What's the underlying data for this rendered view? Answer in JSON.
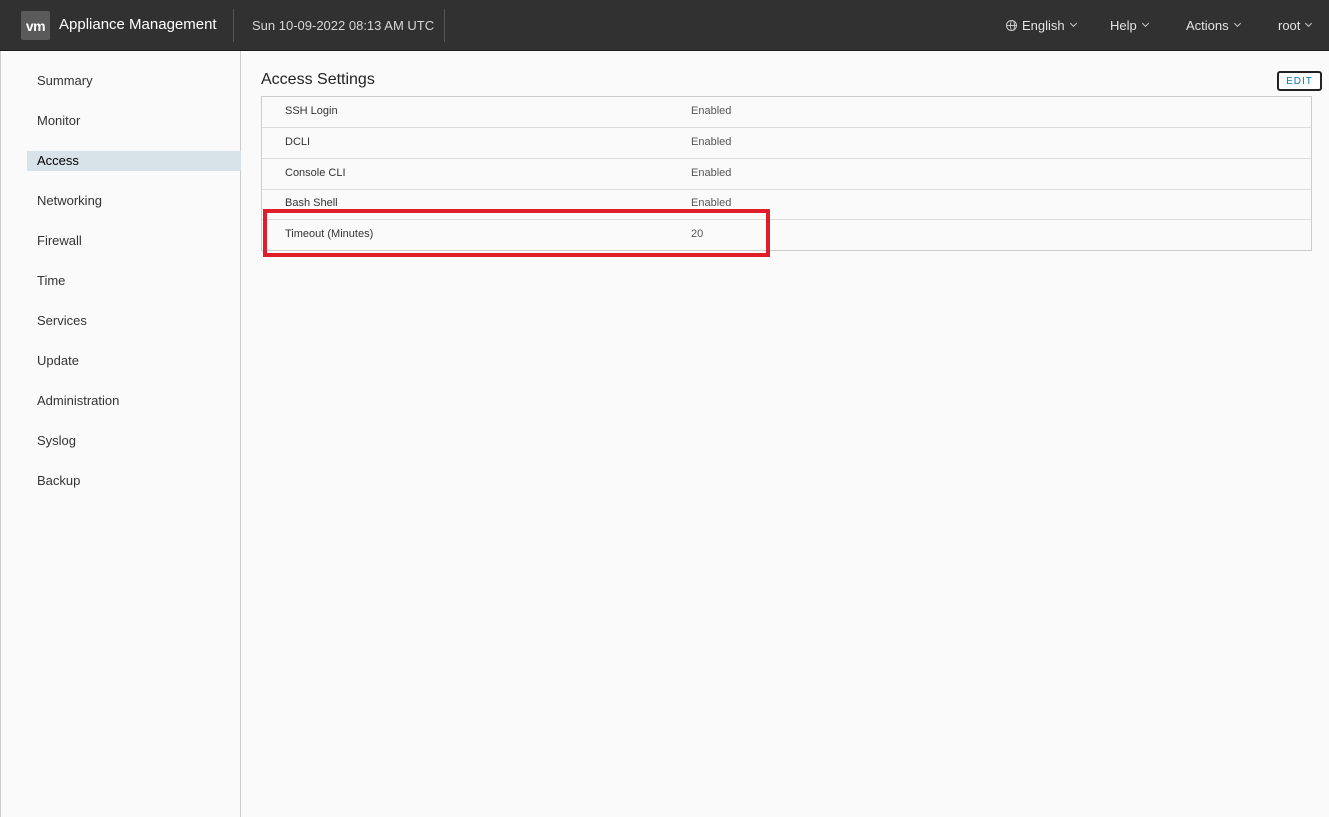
{
  "header": {
    "logo_text": "vm",
    "app_title": "Appliance Management",
    "datetime": "Sun 10-09-2022 08:13 AM UTC",
    "nav": {
      "language": "English",
      "help": "Help",
      "actions": "Actions",
      "user": "root"
    }
  },
  "sidebar": {
    "items": [
      {
        "label": "Summary"
      },
      {
        "label": "Monitor"
      },
      {
        "label": "Access",
        "active": true
      },
      {
        "label": "Networking"
      },
      {
        "label": "Firewall"
      },
      {
        "label": "Time"
      },
      {
        "label": "Services"
      },
      {
        "label": "Update"
      },
      {
        "label": "Administration"
      },
      {
        "label": "Syslog"
      },
      {
        "label": "Backup"
      }
    ]
  },
  "main": {
    "title": "Access Settings",
    "edit_label": "EDIT",
    "rows": [
      {
        "label": "SSH Login",
        "value": "Enabled"
      },
      {
        "label": "DCLI",
        "value": "Enabled"
      },
      {
        "label": "Console CLI",
        "value": "Enabled"
      },
      {
        "label": "Bash Shell",
        "value": "Enabled"
      },
      {
        "label": "Timeout (Minutes)",
        "value": "20"
      }
    ]
  },
  "colors": {
    "header_bg": "#313131",
    "accent": "#0079b8",
    "highlight_box": "#e01e2a",
    "active_nav_bg": "#d8e3e9"
  }
}
